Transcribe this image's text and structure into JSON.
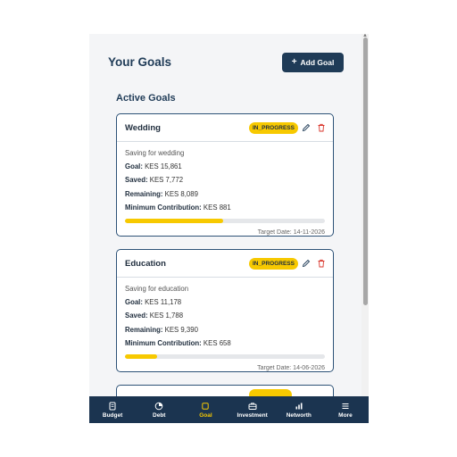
{
  "header": {
    "title": "Your Goals",
    "add_label": "Add Goal"
  },
  "section": {
    "title": "Active Goals"
  },
  "goals": [
    {
      "name": "Wedding",
      "status": "IN_PROGRESS",
      "description": "Saving for wedding",
      "goal_label": "Goal:",
      "goal_value": "KES 15,861",
      "saved_label": "Saved:",
      "saved_value": "KES 7,772",
      "remaining_label": "Remaining:",
      "remaining_value": "KES 8,089",
      "min_label": "Minimum Contribution:",
      "min_value": "KES 881",
      "progress": 0.49,
      "target": "Target Date: 14-11-2026"
    },
    {
      "name": "Education",
      "status": "IN_PROGRESS",
      "description": "Saving for education",
      "goal_label": "Goal:",
      "goal_value": "KES 11,178",
      "saved_label": "Saved:",
      "saved_value": "KES 1,788",
      "remaining_label": "Remaining:",
      "remaining_value": "KES 9,390",
      "min_label": "Minimum Contribution:",
      "min_value": "KES 658",
      "progress": 0.16,
      "target": "Target Date: 14-06-2026"
    }
  ],
  "nav": {
    "items": [
      {
        "label": "Budget",
        "icon": "budget-icon"
      },
      {
        "label": "Debt",
        "icon": "debt-icon"
      },
      {
        "label": "Goal",
        "icon": "goal-icon",
        "active": true
      },
      {
        "label": "Investment",
        "icon": "investment-icon"
      },
      {
        "label": "Networth",
        "icon": "networth-icon"
      },
      {
        "label": "More",
        "icon": "menu-icon"
      }
    ]
  },
  "colors": {
    "primary": "#1f3b57",
    "accent": "#f7c900",
    "delete": "#d9352b"
  }
}
